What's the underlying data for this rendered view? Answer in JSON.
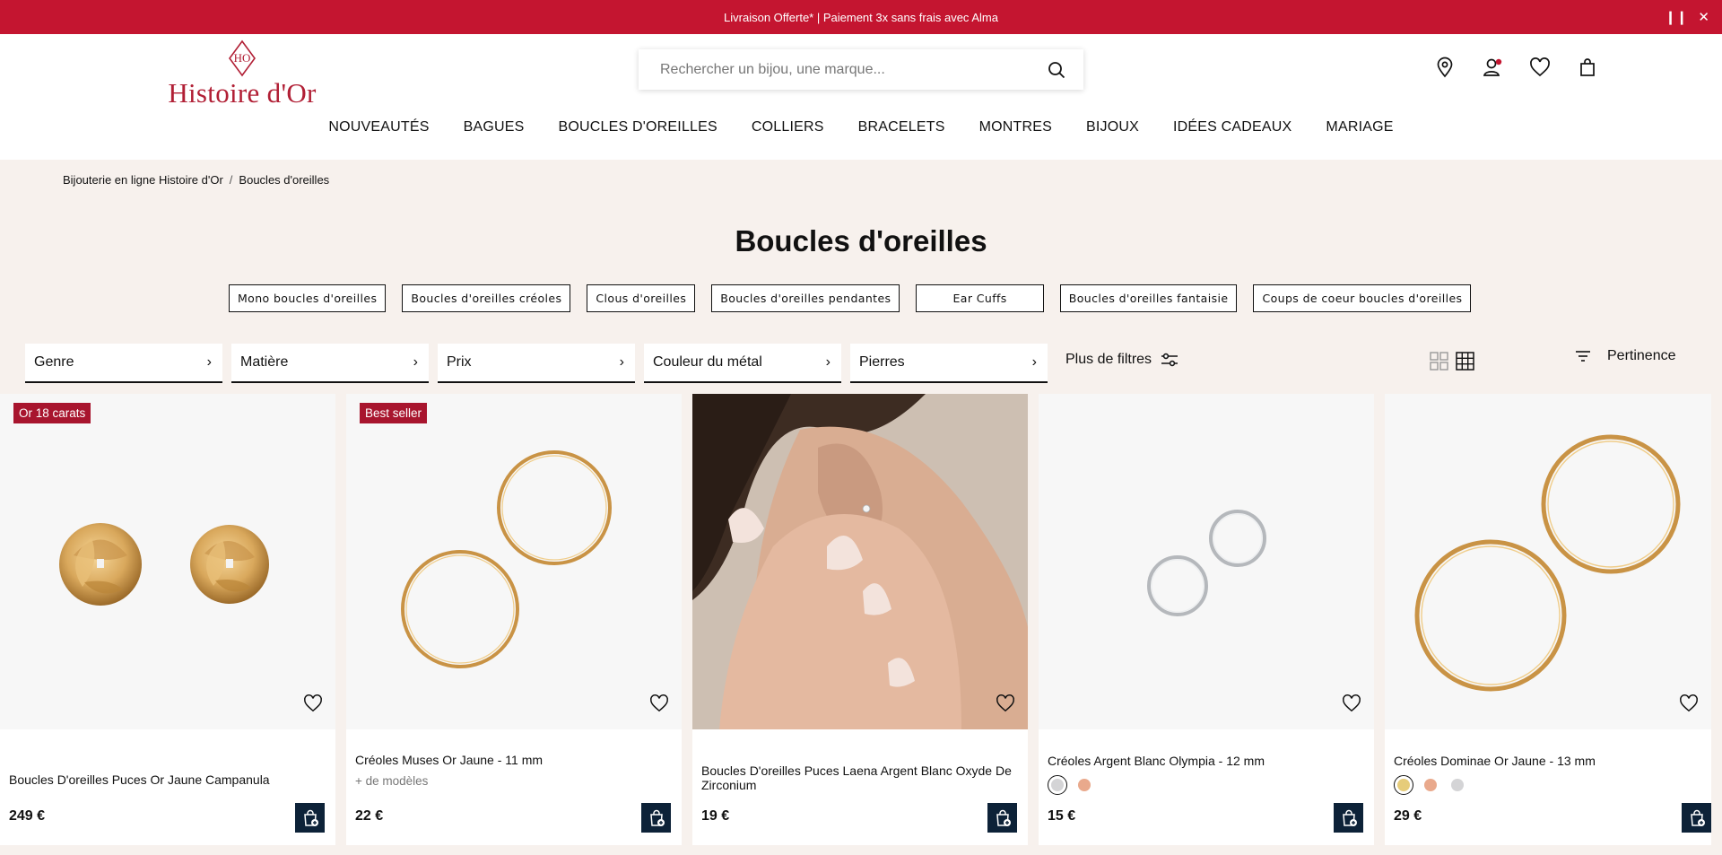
{
  "promo": {
    "text": "Livraison Offerte* | Paiement 3x sans frais avec Alma",
    "pause_icon": "pause-icon",
    "close_icon": "close-icon"
  },
  "header": {
    "logo_text": "Histoire d'Or",
    "search_placeholder": "Rechercher un bijou, une marque...",
    "icons": [
      "store-locator-icon",
      "account-icon",
      "wishlist-icon",
      "cart-icon"
    ]
  },
  "nav": [
    "NOUVEAUTÉS",
    "BAGUES",
    "BOUCLES D'OREILLES",
    "COLLIERS",
    "BRACELETS",
    "MONTRES",
    "BIJOUX",
    "IDÉES CADEAUX",
    "MARIAGE"
  ],
  "breadcrumb": {
    "home": "Bijouterie en ligne Histoire d'Or",
    "sep": "/",
    "current": "Boucles d'oreilles"
  },
  "page_title": "Boucles d'oreilles",
  "chips": [
    "Mono boucles d'oreilles",
    "Boucles d'oreilles créoles",
    "Clous d'oreilles",
    "Boucles d'oreilles pendantes",
    "Ear Cuffs",
    "Boucles d'oreilles fantaisie",
    "Coups de coeur boucles d'oreilles"
  ],
  "filters": [
    "Genre",
    "Matière",
    "Prix",
    "Couleur du métal",
    "Pierres"
  ],
  "more_filters": "Plus de filtres",
  "sort": "Pertinence",
  "products": [
    {
      "badge": "Or 18 carats",
      "name": "Boucles D'oreilles Puces Or Jaune Campanula",
      "price": "249 €",
      "models": "",
      "swatches": []
    },
    {
      "badge": "Best seller",
      "name": "Créoles Muses Or Jaune - 11 mm",
      "price": "22 €",
      "models": "+ de modèles",
      "swatches": []
    },
    {
      "badge": "",
      "name": "Boucles D'oreilles Puces Laena Argent Blanc Oxyde De Zirconium",
      "price": "19 €",
      "models": "",
      "swatches": []
    },
    {
      "badge": "",
      "name": "Créoles Argent Blanc Olympia - 12 mm",
      "price": "15 €",
      "models": "",
      "swatches": [
        "#d4d4d6",
        "#e9a98c"
      ]
    },
    {
      "badge": "",
      "name": "Créoles Dominae Or Jaune - 13 mm",
      "price": "29 €",
      "models": "",
      "swatches": [
        "#e6cc7a",
        "#e9a98c",
        "#d4d4d6"
      ]
    }
  ],
  "colors": {
    "brand_red": "#c41530",
    "badge_red": "#a8152e",
    "cart_navy": "#0d2238",
    "page_bg": "#f7f1ed"
  }
}
